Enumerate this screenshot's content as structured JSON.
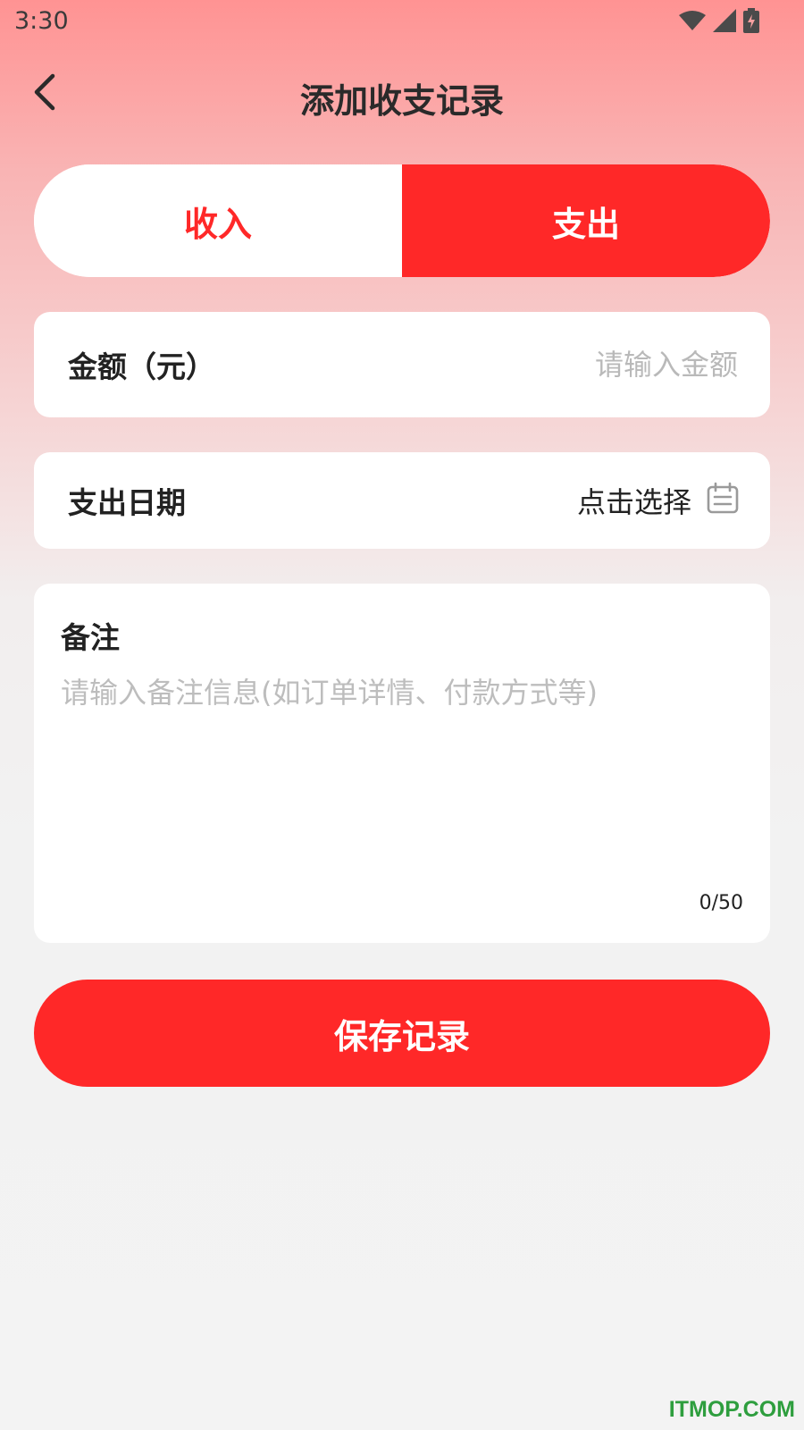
{
  "status_bar": {
    "time": "3:30"
  },
  "header": {
    "title": "添加收支记录"
  },
  "type_toggle": {
    "income_label": "收入",
    "expense_label": "支出",
    "selected": "支出"
  },
  "amount": {
    "label": "金额（元）",
    "placeholder": "请输入金额",
    "value": ""
  },
  "date": {
    "label": "支出日期",
    "picker_text": "点击选择",
    "icon": "calendar-icon"
  },
  "note": {
    "label": "备注",
    "placeholder": "请输入备注信息(如订单详情、付款方式等)",
    "value": "",
    "counter": "0/50"
  },
  "save_button": {
    "label": "保存记录"
  },
  "watermark": "ITMOP.COM",
  "colors": {
    "accent": "#ff2828",
    "watermark": "#2e9e3e"
  }
}
